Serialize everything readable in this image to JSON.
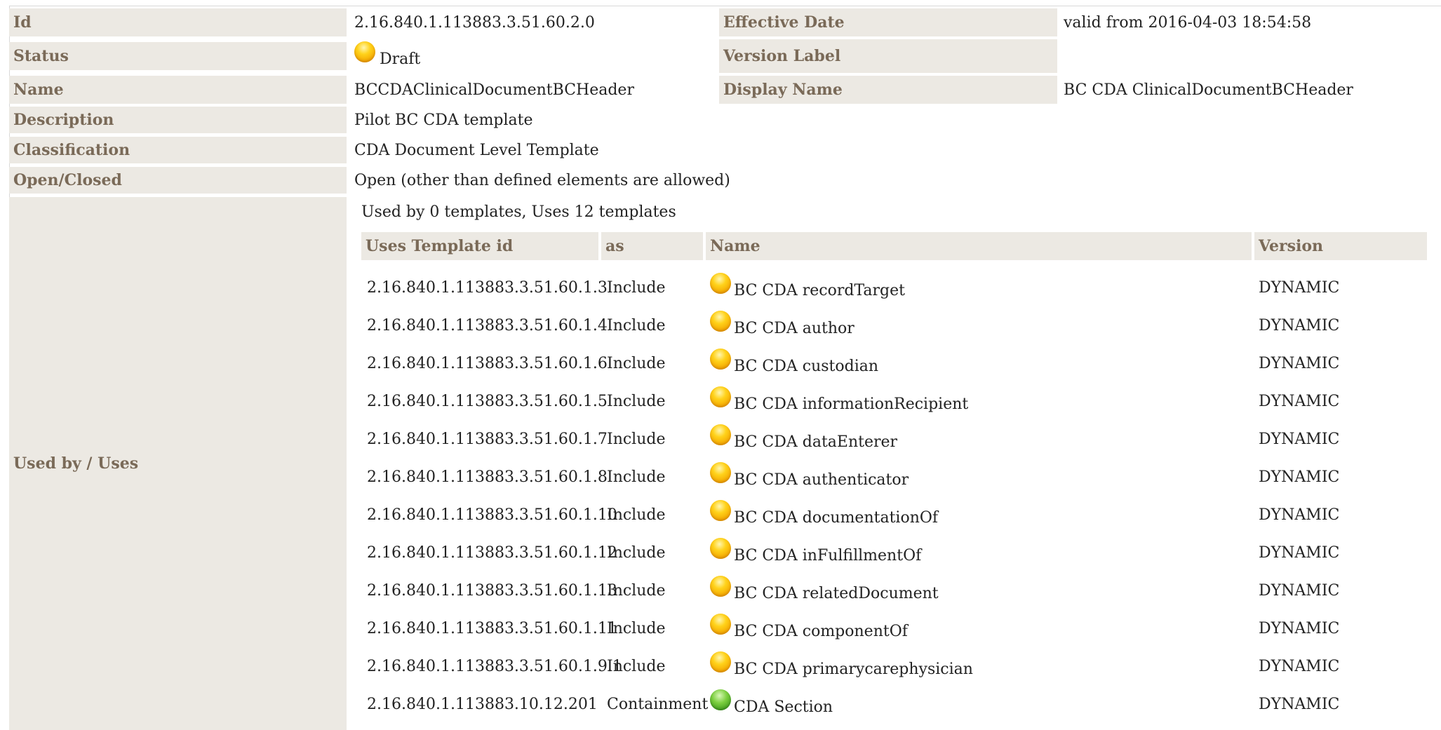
{
  "template": {
    "id_label": "Id",
    "id_value": "2.16.840.1.113883.3.51.60.2.0",
    "effective_label": "Effective Date",
    "effective_value": "valid from 2016-04-03 18:54:58",
    "status_label": "Status",
    "status_value": "Draft",
    "status_icon": "status-draft-icon",
    "version_label": "Version Label",
    "version_value": "",
    "name_label": "Name",
    "name_value": "BCCDAClinicalDocumentBCHeader",
    "display_label": "Display Name",
    "display_value": "BC CDA ClinicalDocumentBCHeader",
    "description_label": "Description",
    "description_value": "Pilot BC CDA template",
    "classification_label": "Classification",
    "classification_value": "CDA Document Level Template",
    "openclosed_label": "Open/Closed",
    "openclosed_value": "Open (other than defined elements are allowed)",
    "usedby_label": "Used by / Uses"
  },
  "usage": {
    "caption": "Used by 0 templates, Uses 12 templates",
    "headers": {
      "template_id": "Uses Template id",
      "as": "as",
      "name": "Name",
      "version": "Version"
    },
    "rows": [
      {
        "template_id": "2.16.840.1.113883.3.51.60.1.3",
        "as": "Include",
        "status": "draft",
        "name": "BC CDA recordTarget",
        "version": "DYNAMIC"
      },
      {
        "template_id": "2.16.840.1.113883.3.51.60.1.4",
        "as": "Include",
        "status": "draft",
        "name": "BC CDA author",
        "version": "DYNAMIC"
      },
      {
        "template_id": "2.16.840.1.113883.3.51.60.1.6",
        "as": "Include",
        "status": "draft",
        "name": "BC CDA custodian",
        "version": "DYNAMIC"
      },
      {
        "template_id": "2.16.840.1.113883.3.51.60.1.5",
        "as": "Include",
        "status": "draft",
        "name": "BC CDA informationRecipient",
        "version": "DYNAMIC"
      },
      {
        "template_id": "2.16.840.1.113883.3.51.60.1.7",
        "as": "Include",
        "status": "draft",
        "name": "BC CDA dataEnterer",
        "version": "DYNAMIC"
      },
      {
        "template_id": "2.16.840.1.113883.3.51.60.1.8",
        "as": "Include",
        "status": "draft",
        "name": "BC CDA authenticator",
        "version": "DYNAMIC"
      },
      {
        "template_id": "2.16.840.1.113883.3.51.60.1.10",
        "as": "Include",
        "status": "draft",
        "name": "BC CDA documentationOf",
        "version": "DYNAMIC"
      },
      {
        "template_id": "2.16.840.1.113883.3.51.60.1.12",
        "as": "Include",
        "status": "draft",
        "name": "BC CDA inFulfillmentOf",
        "version": "DYNAMIC"
      },
      {
        "template_id": "2.16.840.1.113883.3.51.60.1.13",
        "as": "Include",
        "status": "draft",
        "name": "BC CDA relatedDocument",
        "version": "DYNAMIC"
      },
      {
        "template_id": "2.16.840.1.113883.3.51.60.1.11",
        "as": "Include",
        "status": "draft",
        "name": "BC CDA componentOf",
        "version": "DYNAMIC"
      },
      {
        "template_id": "2.16.840.1.113883.3.51.60.1.9.1",
        "as": "Include",
        "status": "draft",
        "name": "BC CDA primarycarephysician",
        "version": "DYNAMIC"
      },
      {
        "template_id": "2.16.840.1.113883.10.12.201",
        "as": "Containment",
        "status": "final",
        "name": "CDA Section",
        "version": "DYNAMIC"
      }
    ]
  },
  "colors": {
    "label_bg": "#ece9e3",
    "label_text": "#7a6a58",
    "draft_status": "#f3a600",
    "final_status": "#46a021"
  }
}
